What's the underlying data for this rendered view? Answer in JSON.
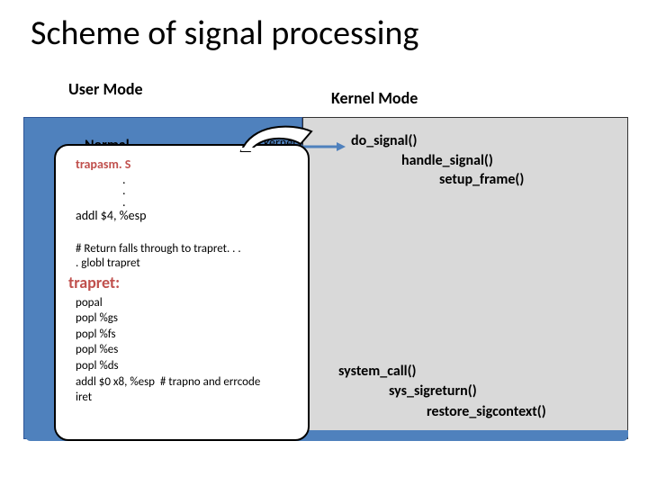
{
  "title": "Scheme of signal processing",
  "labels": {
    "user_mode": "User Mode",
    "kernel_mode": "Kernel Mode",
    "normal": "Normal",
    "to_kernel": "to kernel"
  },
  "kernel_top": {
    "fn1": "do_signal()",
    "fn2": "handle_signal()",
    "fn3": "setup_frame()"
  },
  "kernel_bottom": {
    "fn1": "system_call()",
    "fn2": "sys_sigreturn()",
    "fn3": "restore_sigcontext()"
  },
  "callout": {
    "trapasm": "trapasm. S",
    "dot": ".",
    "addl1": "addl $4, %esp",
    "comment": " # Return falls through to trapret. . .",
    "globl": ". globl trapret",
    "trapret": "trapret:",
    "asm": {
      "l1": "popal",
      "l2": "popl %gs",
      "l3": "popl %fs",
      "l4": "popl %es",
      "l5": "popl %ds",
      "l6": "addl $0 x8, %esp  # trapno and errcode",
      "l7": "iret"
    }
  }
}
